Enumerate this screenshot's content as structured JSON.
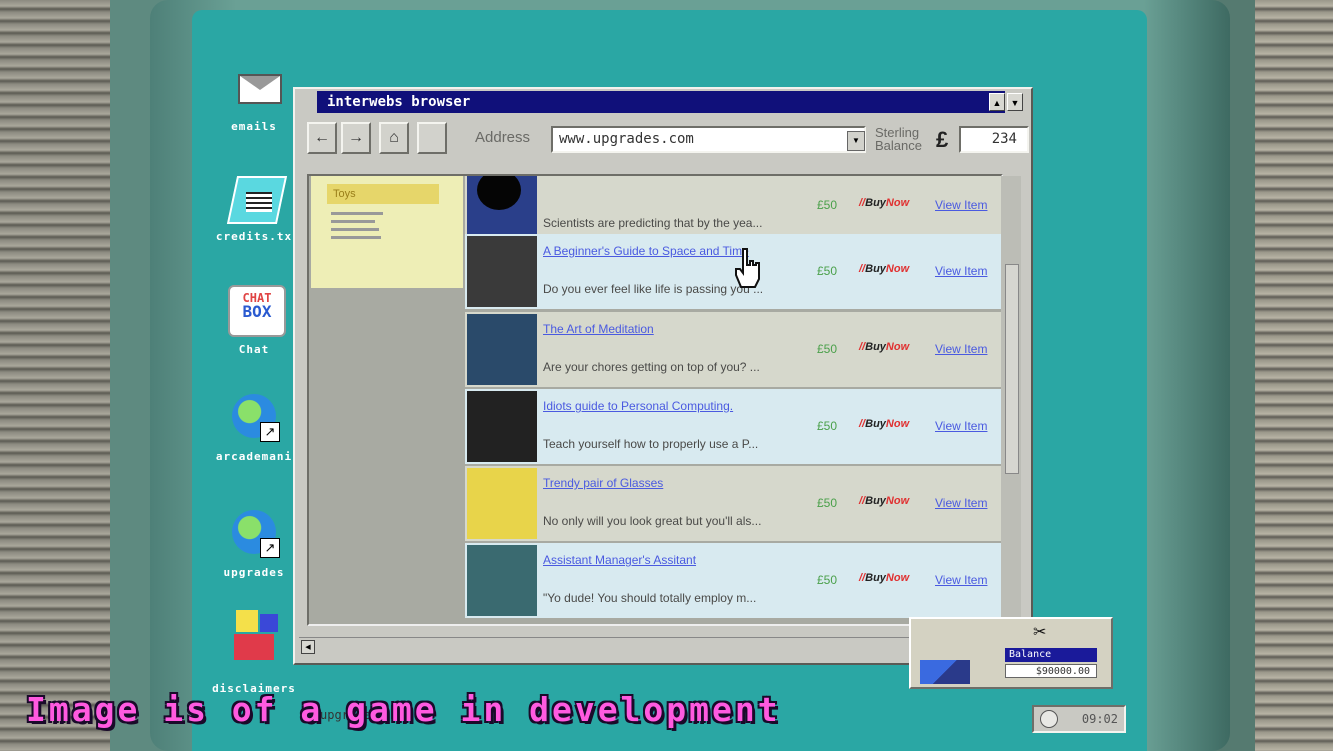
{
  "desktop": {
    "icons": [
      {
        "label": "emails",
        "icon": "mail-icon"
      },
      {
        "label": "credits.tx",
        "icon": "notepad-icon"
      },
      {
        "label": "Chat",
        "icon": "chat-icon"
      },
      {
        "label": "arcademani",
        "icon": "globe-icon"
      },
      {
        "label": "upgrades",
        "icon": "globe-icon"
      },
      {
        "label": "disclaimers",
        "icon": "blocks-icon"
      }
    ],
    "chatbox_line1": "CHAT",
    "chatbox_line2": "BOX"
  },
  "browser": {
    "title": "interwebs browser",
    "address_label": "Address",
    "address": "www.upgrades.com",
    "balance_label_1": "Sterling",
    "balance_label_2": "Balance",
    "currency": "£",
    "balance": "234",
    "sidebar": {
      "heading": "Toys"
    },
    "products": [
      {
        "title": "",
        "desc": "Scientists are predicting that by the yea...",
        "price": "£50",
        "buy": "BuyNow",
        "view": "View Item",
        "thumb": "#2a3f8a"
      },
      {
        "title": "A Beginner's Guide to Space and Time",
        "desc": "Do you ever feel like life is passing you ...",
        "price": "£50",
        "buy": "BuyNow",
        "view": "View Item",
        "thumb": "#3a3a3a"
      },
      {
        "title": "The Art of Meditation",
        "desc": "Are your chores getting on top of you? ...",
        "price": "£50",
        "buy": "BuyNow",
        "view": "View Item",
        "thumb": "#2a4a6a"
      },
      {
        "title": "Idiots guide to Personal Computing.",
        "desc": "Teach yourself how to properly use a P...",
        "price": "£50",
        "buy": "BuyNow",
        "view": "View Item",
        "thumb": "#222222"
      },
      {
        "title": "Trendy pair of Glasses",
        "desc": "No only will you look great but you'll als...",
        "price": "£50",
        "buy": "BuyNow",
        "view": "View Item",
        "thumb": "#e8d44a"
      },
      {
        "title": "Assistant Manager's Assitant",
        "desc": "\"Yo dude! You should totally employ m...",
        "price": "£50",
        "buy": "BuyNow",
        "view": "View Item",
        "thumb": "#3a6a70"
      }
    ]
  },
  "widget": {
    "label": "Balance",
    "value": "$90000.00"
  },
  "taskbar": {
    "item": "upgrades",
    "clock": "09:02"
  },
  "overlay_text": "Image is of a game in development"
}
